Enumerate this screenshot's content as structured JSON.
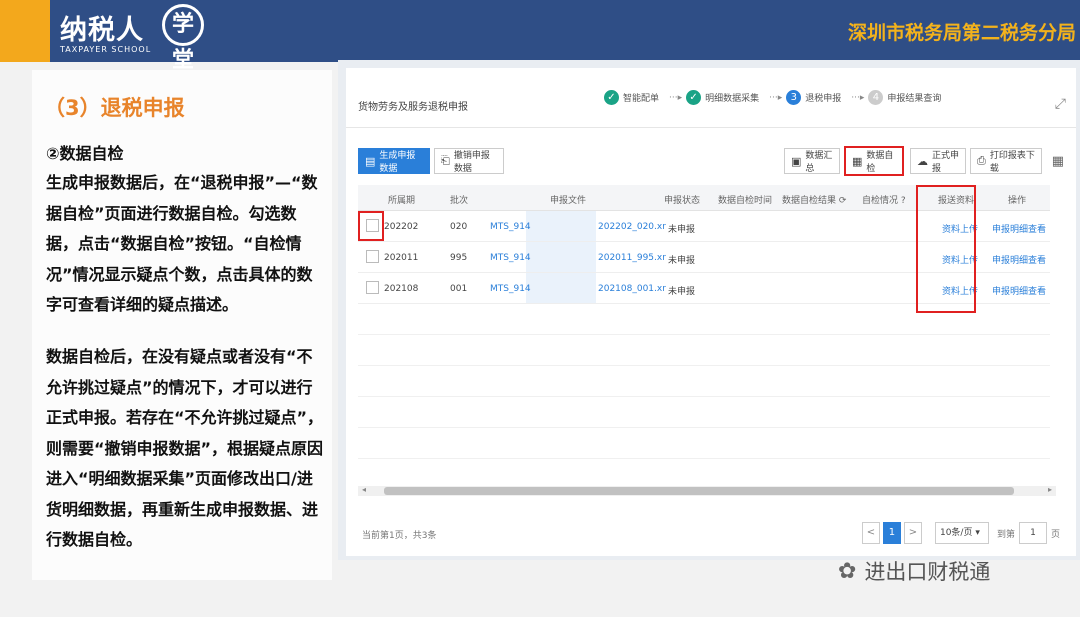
{
  "header": {
    "logo_text": "纳税人",
    "logo_circle": "学堂",
    "logo_sub": "TAXPAYER SCHOOL",
    "right_title": "深圳市税务局第二税务分局"
  },
  "left": {
    "section_title": "（3）退税申报",
    "sub_title": "②数据自检",
    "para1": "生成申报数据后，在“退税申报”—“数据自检”页面进行数据自检。勾选数据，点击“数据自检”按钮。“自检情况”情况显示疑点个数，点击具体的数字可查看详细的疑点描述。",
    "para2": "数据自检后，在没有疑点或者没有“不允许挑过疑点”的情况下，才可以进行正式申报。若存在“不允许挑过疑点”，则需要“撤销申报数据”，根据疑点原因进入“明细数据采集”页面修改出口/进货明细数据，再重新生成申报数据、进行数据自检。"
  },
  "screen": {
    "page_title": "货物劳务及服务退税申报",
    "steps": [
      {
        "num": "✓",
        "label": "智能配单"
      },
      {
        "num": "✓",
        "label": "明细数据采集"
      },
      {
        "num": "3",
        "label": "退税申报"
      },
      {
        "num": "4",
        "label": "申报结果查询"
      }
    ],
    "toolbar": {
      "generate": "生成申报数据",
      "revoke": "撤销申报数据",
      "summary": "数据汇总",
      "self_check": "数据自检",
      "formal": "正式申报",
      "print": "打印报表下载"
    },
    "columns": [
      "所属期",
      "批次",
      "申报文件",
      "申报状态",
      "数据自检时间",
      "数据自检结果",
      "自检情况",
      "报送资料",
      "操作"
    ],
    "rows": [
      {
        "period": "202202",
        "batch": "020",
        "file_a": "MTS_914",
        "file_b": "202202_020.xr",
        "status": "未申报",
        "material": "资料上传",
        "op": "申报明细查看"
      },
      {
        "period": "202011",
        "batch": "995",
        "file_a": "MTS_914",
        "file_b": "202011_995.xr",
        "status": "未申报",
        "material": "资料上传",
        "op": "申报明细查看"
      },
      {
        "period": "202108",
        "batch": "001",
        "file_a": "MTS_914",
        "file_b": "202108_001.xr",
        "status": "未申报",
        "material": "资料上传",
        "op": "申报明细查看"
      }
    ],
    "total_text": "当前第1页，共3条",
    "pagination": {
      "prev": "<",
      "current": "1",
      "next": ">",
      "page_size": "10条/页",
      "goto_label": "到第",
      "goto_value": "1",
      "page_unit": "页"
    }
  },
  "watermark": "进出口财税通"
}
